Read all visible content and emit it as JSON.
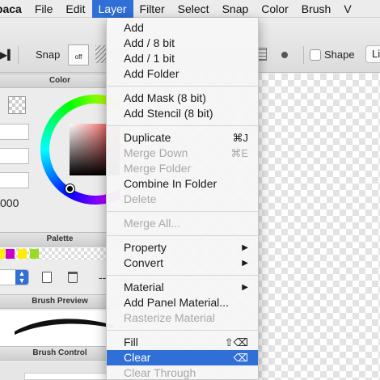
{
  "menubar": {
    "items": [
      "lpaca",
      "File",
      "Edit",
      "Layer",
      "Filter",
      "Select",
      "Snap",
      "Color",
      "Brush",
      "V"
    ]
  },
  "toolbar": {
    "snap_label": "Snap",
    "snap_toggle": "off",
    "shape_label": "Shape",
    "right_cut": "Li"
  },
  "color_panel": {
    "title": "Color",
    "value_cut": "000"
  },
  "palette_panel": {
    "title": "Palette",
    "swatches": [
      "#ffee00",
      "#cc00cc",
      "#ffee00",
      "#99dd22"
    ]
  },
  "brush_preview_panel": {
    "title": "Brush Preview"
  },
  "brush_control_panel": {
    "title": "Brush Control"
  },
  "layer_menu": {
    "groups": [
      [
        {
          "label": "Add"
        },
        {
          "label": "Add / 8 bit"
        },
        {
          "label": "Add / 1 bit"
        },
        {
          "label": "Add Folder"
        }
      ],
      [
        {
          "label": "Add Mask (8 bit)"
        },
        {
          "label": "Add Stencil (8 bit)"
        }
      ],
      [
        {
          "label": "Duplicate",
          "shortcut": "⌘J"
        },
        {
          "label": "Merge Down",
          "shortcut": "⌘E",
          "disabled": true
        },
        {
          "label": "Merge Folder",
          "disabled": true
        },
        {
          "label": "Combine In Folder"
        },
        {
          "label": "Delete",
          "disabled": true
        }
      ],
      [
        {
          "label": "Merge All...",
          "disabled": true
        }
      ],
      [
        {
          "label": "Property",
          "submenu": true
        },
        {
          "label": "Convert",
          "submenu": true
        }
      ],
      [
        {
          "label": "Material",
          "submenu": true
        },
        {
          "label": "Add Panel Material..."
        },
        {
          "label": "Rasterize Material",
          "disabled": true
        }
      ],
      [
        {
          "label": "Fill",
          "shortcut": "⇧⌫"
        },
        {
          "label": "Clear",
          "shortcut": "⌫",
          "selected": true
        },
        {
          "label": "Clear Through",
          "disabled": true
        }
      ]
    ]
  },
  "colors": {
    "accent": "#2f6fd6",
    "menu_bg": "#f6f6f6",
    "disabled_text": "#a8a8a8"
  }
}
